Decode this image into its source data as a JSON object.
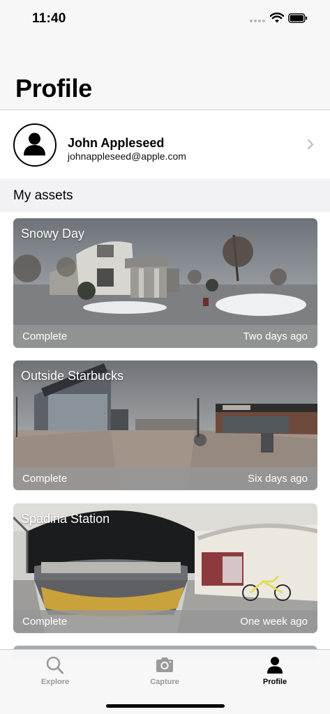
{
  "status_bar": {
    "time": "11:40"
  },
  "header": {
    "title": "Profile"
  },
  "profile": {
    "name": "John Appleseed",
    "email": "johnappleseed@apple.com"
  },
  "section": {
    "title": "My assets"
  },
  "assets": [
    {
      "title": "Snowy Day",
      "status": "Complete",
      "date": "Two days ago"
    },
    {
      "title": "Outside Starbucks",
      "status": "Complete",
      "date": "Six days ago"
    },
    {
      "title": "Spadina Station",
      "status": "Complete",
      "date": "One week ago"
    }
  ],
  "tab_bar": {
    "tabs": [
      {
        "label": "Explore",
        "icon": "magnifier-icon",
        "active": false
      },
      {
        "label": "Capture",
        "icon": "camera-icon",
        "active": false
      },
      {
        "label": "Profile",
        "icon": "person-icon",
        "active": true
      }
    ]
  },
  "colors": {
    "accent_active": "#000000",
    "inactive": "#9a9a9a",
    "footer_overlay": "#969696"
  }
}
